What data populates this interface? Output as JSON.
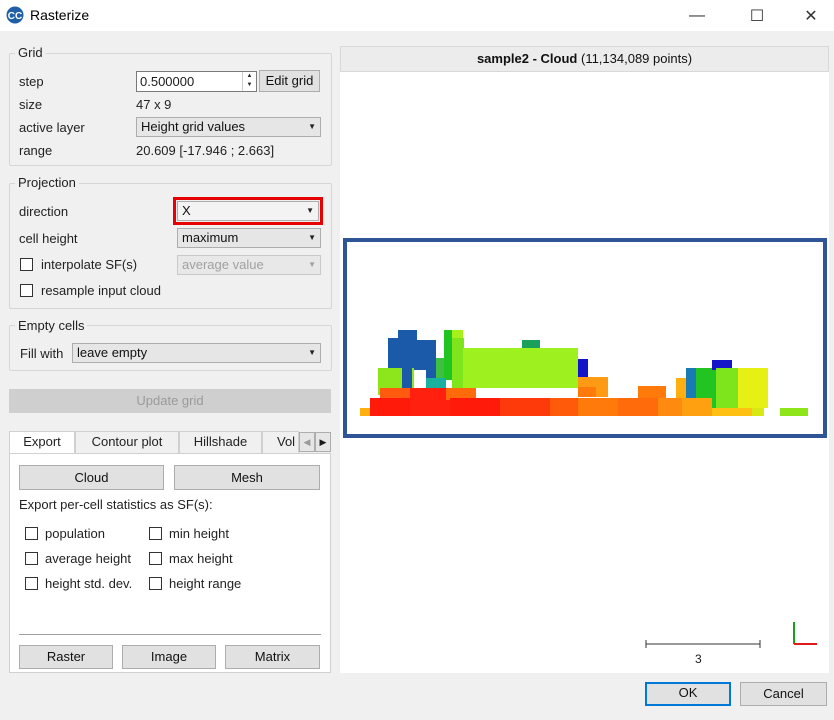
{
  "window": {
    "title": "Rasterize",
    "app_icon": "cloudcompare-logo",
    "minimize_glyph": "—",
    "maximize_glyph": "☐",
    "close_glyph": "✕"
  },
  "grid": {
    "title": "Grid",
    "step_label": "step",
    "step_value": "0.500000",
    "edit_grid_button": "Edit grid",
    "size_label": "size",
    "size_value": "47 x 9",
    "active_layer_label": "active layer",
    "active_layer_value": "Height grid values",
    "range_label": "range",
    "range_value": "20.609 [-17.946 ; 2.663]"
  },
  "projection": {
    "title": "Projection",
    "direction_label": "direction",
    "direction_value": "X",
    "cell_height_label": "cell height",
    "cell_height_value": "maximum",
    "interpolate_label": "interpolate SF(s)",
    "interpolate_value": "average value",
    "resample_label": "resample input cloud"
  },
  "empty_cells": {
    "title": "Empty cells",
    "fill_label": "Fill with",
    "fill_value": "leave empty"
  },
  "update_grid_button": "Update grid",
  "tabs": [
    {
      "label": "Export"
    },
    {
      "label": "Contour plot"
    },
    {
      "label": "Hillshade"
    },
    {
      "label": "Vol"
    }
  ],
  "tab_scroll_glyph": "▶",
  "export": {
    "cloud_button": "Cloud",
    "mesh_button": "Mesh",
    "stats_label": "Export per-cell statistics as SF(s):",
    "stats": [
      "population",
      "min height",
      "average height",
      "max height",
      "height std. dev.",
      "height range"
    ],
    "raster_button": "Raster",
    "image_button": "Image",
    "matrix_button": "Matrix"
  },
  "view": {
    "header_bold": "sample2 - Cloud",
    "header_rest": " (11,134,089 points)",
    "scale_label": "3"
  },
  "footer": {
    "ok_button": "OK",
    "cancel_button": "Cancel"
  },
  "colors": {
    "highlight": "#e60000",
    "selection_box": "#2f5597",
    "primary_button_border": "#0078d7"
  }
}
